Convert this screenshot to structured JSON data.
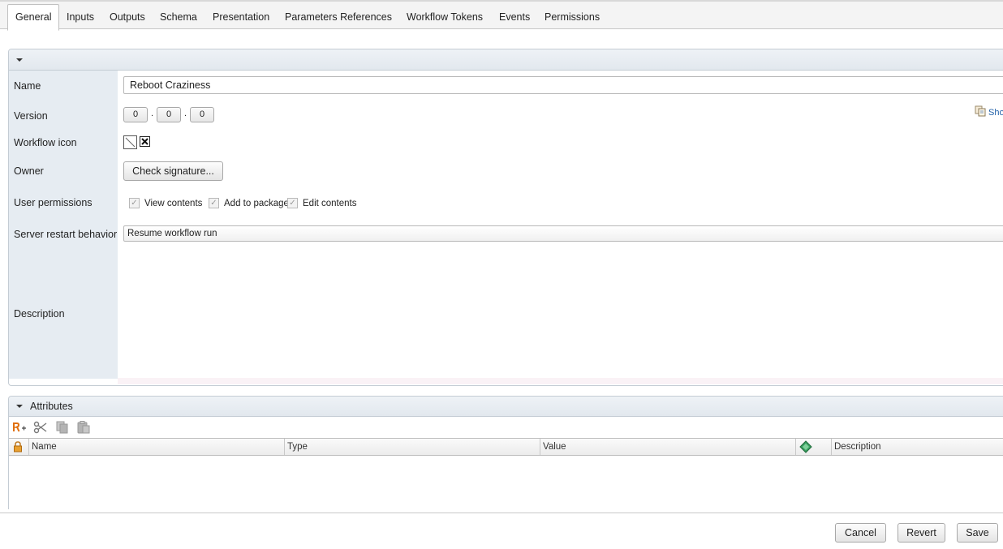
{
  "tabs": [
    "General",
    "Inputs",
    "Outputs",
    "Schema",
    "Presentation",
    "Parameters References",
    "Workflow Tokens",
    "Events",
    "Permissions"
  ],
  "active_tab": "General",
  "form": {
    "name_label": "Name",
    "name_value": "Reboot Craziness",
    "version_label": "Version",
    "version": [
      "0",
      "0",
      "0"
    ],
    "version_sep": ".",
    "show_link": "Sho",
    "icon_label": "Workflow icon",
    "owner_label": "Owner",
    "check_signature": "Check signature...",
    "permissions_label": "User permissions",
    "permissions": [
      "View contents",
      "Add to package",
      "Edit contents"
    ],
    "restart_label": "Server restart behavior",
    "restart_value": "Resume workflow run",
    "description_label": "Description",
    "description_value": ""
  },
  "attributes": {
    "title": "Attributes",
    "columns": [
      "Name",
      "Type",
      "Value",
      "Description"
    ],
    "rows": []
  },
  "footer": {
    "cancel": "Cancel",
    "revert": "Revert",
    "save": "Save"
  },
  "icons": [
    "collapse-arrow-icon",
    "add-attribute-icon",
    "cut-icon",
    "copy-icon",
    "paste-icon",
    "lock-icon",
    "binding-icon",
    "show-details-icon",
    "workflow-icon-placeholder",
    "clear-icon"
  ]
}
